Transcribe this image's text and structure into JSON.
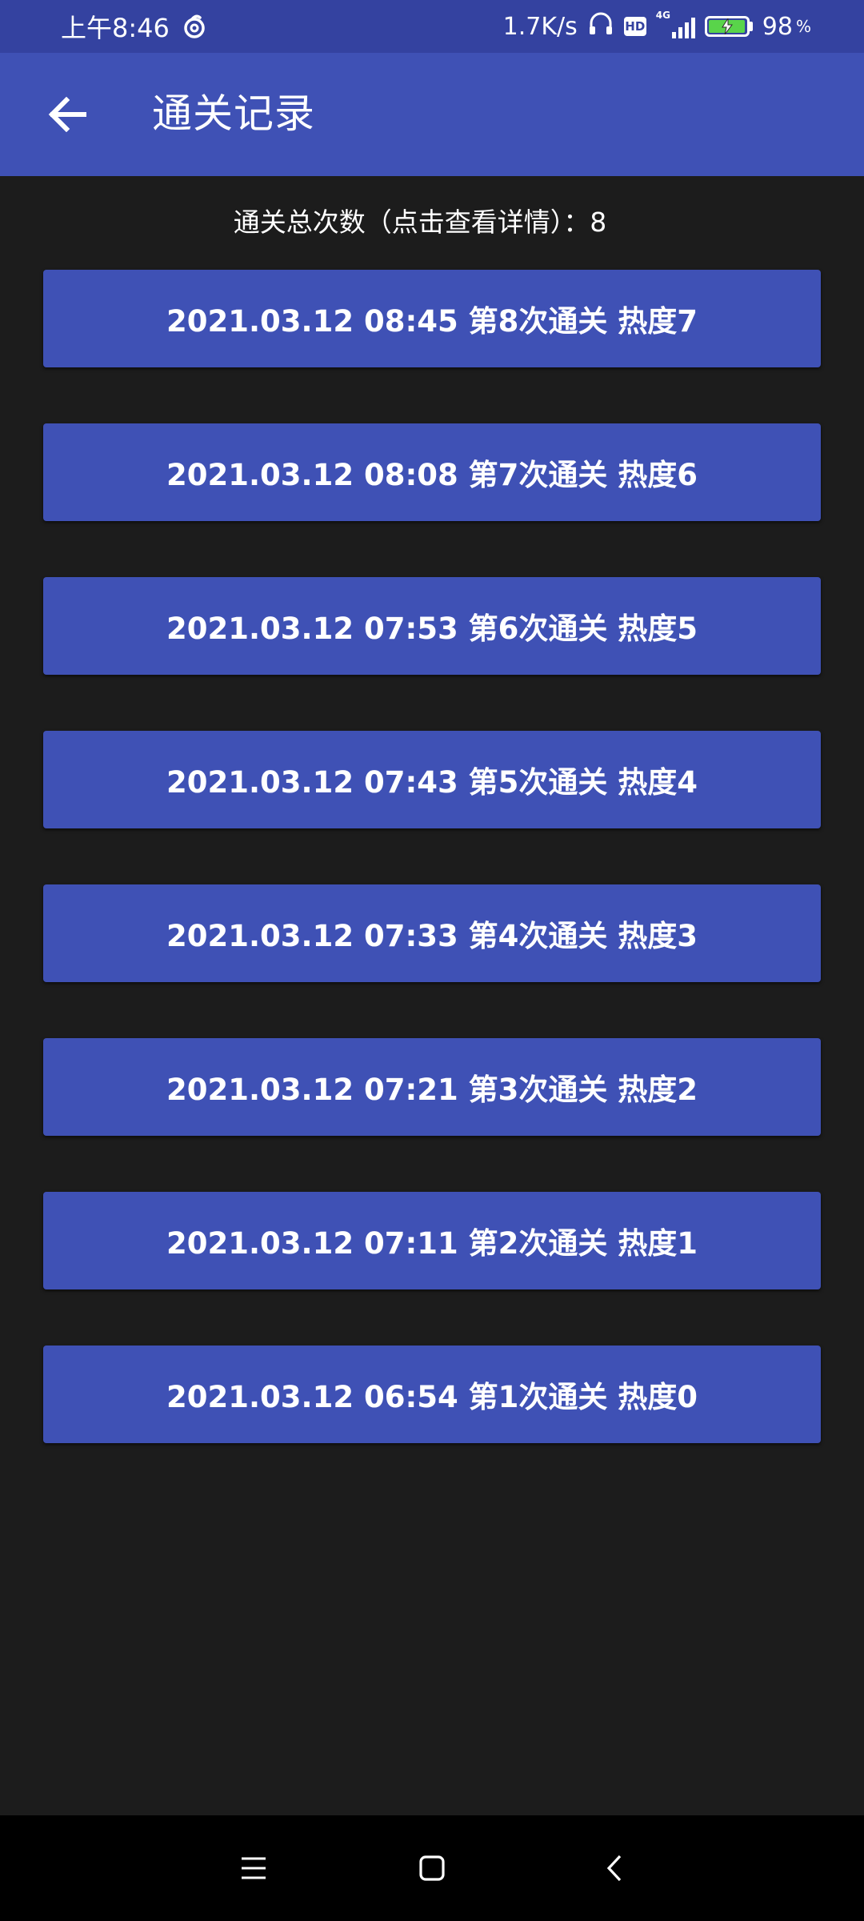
{
  "status_bar": {
    "time": "上午8:46",
    "net_speed": "1.7K/s",
    "hd_badge": "HD",
    "network_type": "4G",
    "battery_percent": "98",
    "battery_unit": "%",
    "battery_level": 0.98,
    "icons": [
      "netease-music-icon",
      "headphones-icon",
      "hd-icon",
      "signal-icon",
      "battery-charging-icon"
    ]
  },
  "app_bar": {
    "title": "通关记录",
    "back_icon": "arrow-left-icon"
  },
  "summary": {
    "text": "通关总次数（点击查看详情）：8"
  },
  "records": [
    "2021.03.12 08:45 第8次通关 热度7",
    "2021.03.12 08:08 第7次通关 热度6",
    "2021.03.12 07:53 第6次通关 热度5",
    "2021.03.12 07:43 第5次通关 热度4",
    "2021.03.12 07:33 第4次通关 热度3",
    "2021.03.12 07:21 第3次通关 热度2",
    "2021.03.12 07:11 第2次通关 热度1",
    "2021.03.12 06:54 第1次通关 热度0"
  ],
  "nav_bar": {
    "icons": [
      "menu-icon",
      "home-icon",
      "back-icon"
    ]
  },
  "colors": {
    "primary": "#3f51b5",
    "status_bar": "#3442a0",
    "background": "#1c1c1c",
    "battery_fill": "#59d44a"
  }
}
